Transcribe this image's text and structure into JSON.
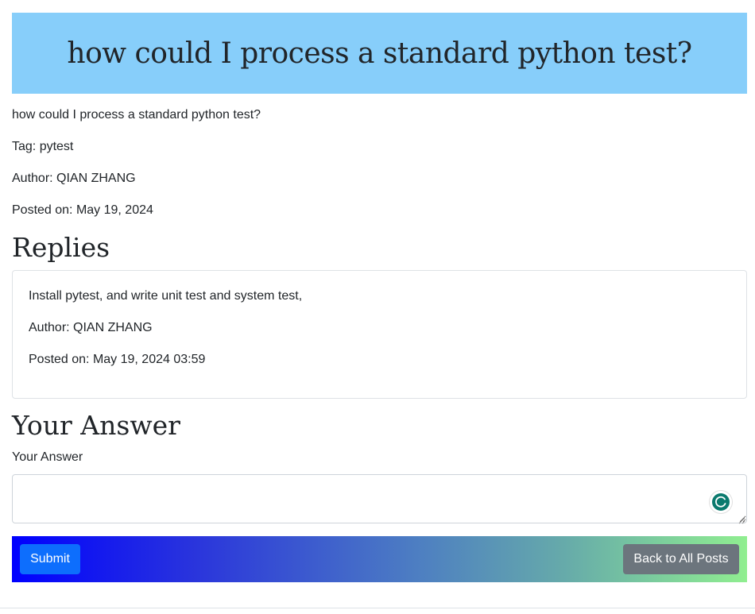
{
  "post": {
    "title": "how could I process a standard python test?",
    "body": "how could I process a standard python test?",
    "tag": "Tag: pytest",
    "author": "Author: QIAN ZHANG",
    "posted_on": "Posted on: May 19, 2024"
  },
  "replies": {
    "heading": "Replies",
    "items": [
      {
        "content": "Install pytest, and write unit test and system test,",
        "author": "Author: QIAN ZHANG",
        "posted_on": "Posted on: May 19, 2024 03:59"
      }
    ]
  },
  "answer_form": {
    "heading": "Your Answer",
    "label": "Your Answer",
    "value": "",
    "placeholder": ""
  },
  "actions": {
    "submit_label": "Submit",
    "back_label": "Back to All Posts"
  },
  "colors": {
    "banner": "#87cefa",
    "submit": "#0d6efd",
    "back": "#6c757d",
    "bar_start": "#0000ff",
    "bar_end": "#90ee90"
  },
  "icons": {
    "assistant": "grammar-assistant-icon",
    "resize": "resize-grip-icon"
  }
}
